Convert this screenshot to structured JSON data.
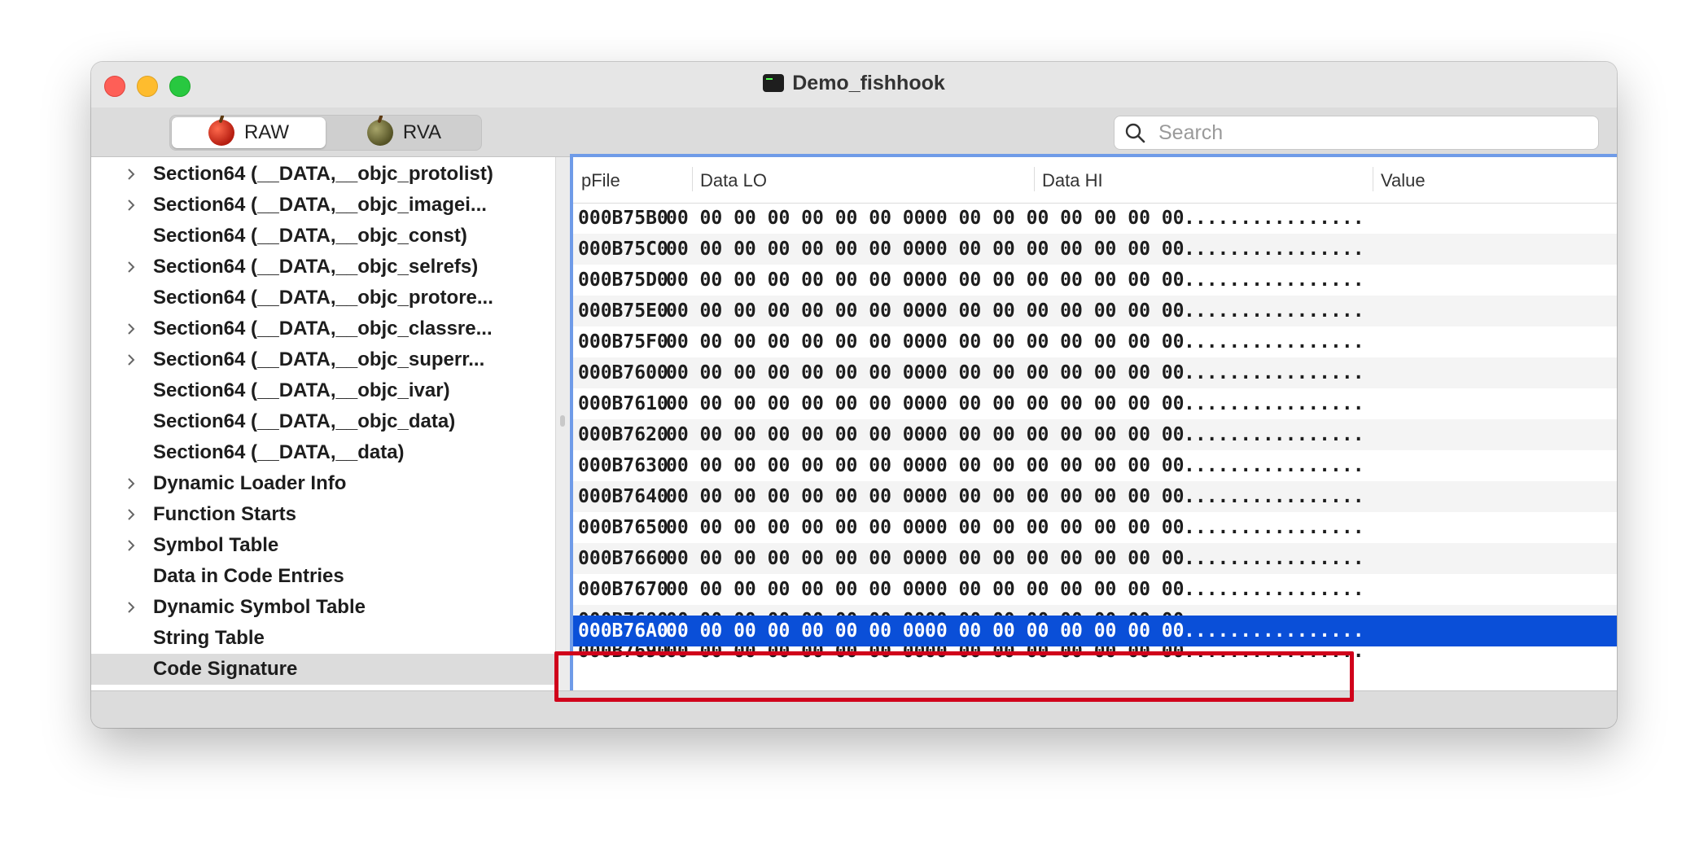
{
  "window": {
    "title": "Demo_fishhook",
    "icon": "terminal-icon"
  },
  "toolbar": {
    "segments": [
      {
        "label": "RAW",
        "icon": "red-apple-icon",
        "active": true
      },
      {
        "label": "RVA",
        "icon": "green-apple-icon",
        "active": false
      }
    ],
    "search": {
      "placeholder": "Search",
      "value": ""
    }
  },
  "sidebar": {
    "items": [
      {
        "label": "Section64 (__DATA,__objc_protolist)",
        "expandable": true,
        "selected": false
      },
      {
        "label": "Section64 (__DATA,__objc_imagei...",
        "expandable": true,
        "selected": false
      },
      {
        "label": "Section64 (__DATA,__objc_const)",
        "expandable": false,
        "selected": false
      },
      {
        "label": "Section64 (__DATA,__objc_selrefs)",
        "expandable": true,
        "selected": false
      },
      {
        "label": "Section64 (__DATA,__objc_protore...",
        "expandable": false,
        "selected": false
      },
      {
        "label": "Section64 (__DATA,__objc_classre...",
        "expandable": true,
        "selected": false
      },
      {
        "label": "Section64 (__DATA,__objc_superr...",
        "expandable": true,
        "selected": false
      },
      {
        "label": "Section64 (__DATA,__objc_ivar)",
        "expandable": false,
        "selected": false
      },
      {
        "label": "Section64 (__DATA,__objc_data)",
        "expandable": false,
        "selected": false
      },
      {
        "label": "Section64 (__DATA,__data)",
        "expandable": false,
        "selected": false
      },
      {
        "label": "Dynamic Loader Info",
        "expandable": true,
        "selected": false
      },
      {
        "label": "Function Starts",
        "expandable": true,
        "selected": false
      },
      {
        "label": "Symbol Table",
        "expandable": true,
        "selected": false
      },
      {
        "label": "Data in Code Entries",
        "expandable": false,
        "selected": false
      },
      {
        "label": "Dynamic Symbol Table",
        "expandable": true,
        "selected": false
      },
      {
        "label": "String Table",
        "expandable": false,
        "selected": false
      },
      {
        "label": "Code Signature",
        "expandable": false,
        "selected": true
      }
    ]
  },
  "table": {
    "columns": [
      "pFile",
      "Data LO",
      "Data HI",
      "Value"
    ],
    "rows": [
      {
        "pfile": "000B75B0",
        "lo": "00 00 00 00 00 00 00 00",
        "hi": "00 00 00 00 00 00 00 00",
        "value": "................"
      },
      {
        "pfile": "000B75C0",
        "lo": "00 00 00 00 00 00 00 00",
        "hi": "00 00 00 00 00 00 00 00",
        "value": "................"
      },
      {
        "pfile": "000B75D0",
        "lo": "00 00 00 00 00 00 00 00",
        "hi": "00 00 00 00 00 00 00 00",
        "value": "................"
      },
      {
        "pfile": "000B75E0",
        "lo": "00 00 00 00 00 00 00 00",
        "hi": "00 00 00 00 00 00 00 00",
        "value": "................"
      },
      {
        "pfile": "000B75F0",
        "lo": "00 00 00 00 00 00 00 00",
        "hi": "00 00 00 00 00 00 00 00",
        "value": "................"
      },
      {
        "pfile": "000B7600",
        "lo": "00 00 00 00 00 00 00 00",
        "hi": "00 00 00 00 00 00 00 00",
        "value": "................"
      },
      {
        "pfile": "000B7610",
        "lo": "00 00 00 00 00 00 00 00",
        "hi": "00 00 00 00 00 00 00 00",
        "value": "................"
      },
      {
        "pfile": "000B7620",
        "lo": "00 00 00 00 00 00 00 00",
        "hi": "00 00 00 00 00 00 00 00",
        "value": "................"
      },
      {
        "pfile": "000B7630",
        "lo": "00 00 00 00 00 00 00 00",
        "hi": "00 00 00 00 00 00 00 00",
        "value": "................"
      },
      {
        "pfile": "000B7640",
        "lo": "00 00 00 00 00 00 00 00",
        "hi": "00 00 00 00 00 00 00 00",
        "value": "................"
      },
      {
        "pfile": "000B7650",
        "lo": "00 00 00 00 00 00 00 00",
        "hi": "00 00 00 00 00 00 00 00",
        "value": "................"
      },
      {
        "pfile": "000B7660",
        "lo": "00 00 00 00 00 00 00 00",
        "hi": "00 00 00 00 00 00 00 00",
        "value": "................"
      },
      {
        "pfile": "000B7670",
        "lo": "00 00 00 00 00 00 00 00",
        "hi": "00 00 00 00 00 00 00 00",
        "value": "................"
      },
      {
        "pfile": "000B7680",
        "lo": "00 00 00 00 00 00 00 00",
        "hi": "00 00 00 00 00 00 00 00",
        "value": "................"
      },
      {
        "pfile": "000B7690",
        "lo": "00 00 00 00 00 00 00 00",
        "hi": "00 00 00 00 00 00 00 00",
        "value": "................"
      },
      {
        "pfile": "000B76A0",
        "lo": "00 00 00 00 00 00 00 00",
        "hi": "00 00 00 00 00 00 00 00",
        "value": "................",
        "selected": true
      }
    ]
  },
  "colors": {
    "selection": "#0a4fd8",
    "focus_ring": "#6f9be8",
    "annotation_box": "#d0021b"
  }
}
